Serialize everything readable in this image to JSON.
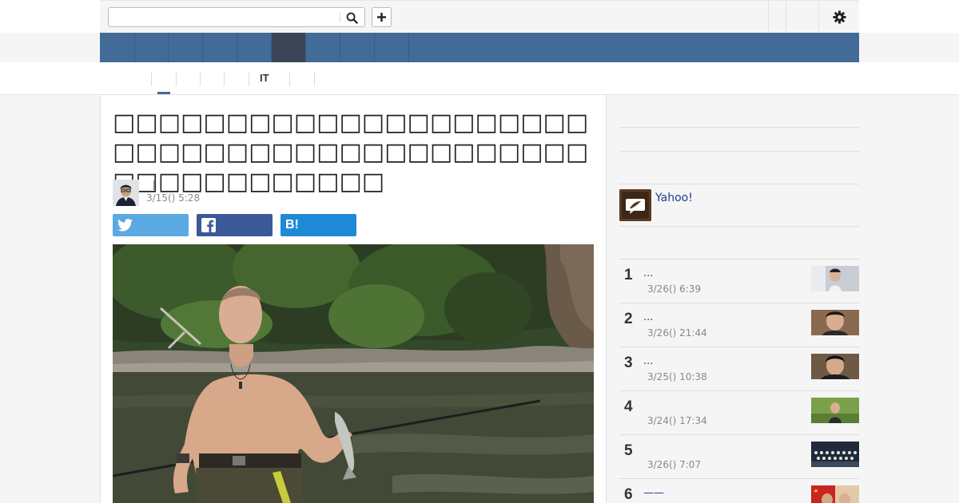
{
  "search": {
    "value": "",
    "placeholder": ""
  },
  "subnav": {
    "it_label": "IT"
  },
  "article": {
    "headline": "□□□□□□□□□□□□□□□□□□□□□□□□□□□□□□□□□□□□□□□□□□□□□□□□□□□□□□",
    "published": "3/15() 5:28"
  },
  "share": {
    "hatena_label": "B!"
  },
  "sidebar": {
    "yahoo_label": "Yahoo!",
    "ranking": [
      {
        "rank": "1",
        "title": "...",
        "date": "3/26() 6:39"
      },
      {
        "rank": "2",
        "title": "...",
        "date": "3/26() 21:44"
      },
      {
        "rank": "3",
        "title": "...",
        "date": "3/25() 10:38"
      },
      {
        "rank": "4",
        "title": "",
        "date": "3/24() 17:34"
      },
      {
        "rank": "5",
        "title": "",
        "date": "3/26() 7:07"
      },
      {
        "rank": "6",
        "title": "——",
        "date": ""
      }
    ]
  },
  "icons": {
    "search": "search-icon",
    "add": "plus-icon",
    "settings": "gear-icon",
    "twitter": "twitter-icon",
    "facebook": "facebook-icon",
    "hatena": "hatena-bookmark-icon"
  },
  "colors": {
    "nav": "#426b97",
    "nav_active": "#3a4657",
    "twitter": "#5aa9e2",
    "facebook": "#3b5998",
    "hatena": "#1e8ad6",
    "link": "#1e3d8c"
  }
}
